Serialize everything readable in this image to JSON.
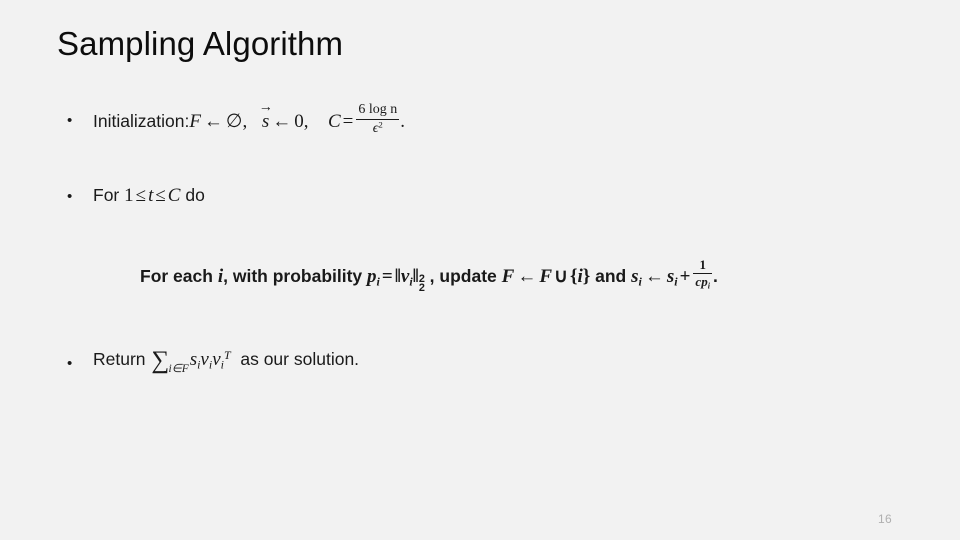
{
  "slide": {
    "title": "Sampling Algorithm",
    "page_number": "16",
    "background_color": "#f2f2f2",
    "text_color": "#1a1a1a",
    "page_number_color": "#b0b0b0"
  },
  "bullets": [
    {
      "marker": "•",
      "kind": "bullet",
      "plain_text": "Initialization: F ← ∅,  s⃗ ← 0,  C = 6 log n / ε².",
      "parts": {
        "label": "Initialization:",
        "var_f": "F",
        "arrow": "←",
        "empty_set": "∅",
        "comma1": ",",
        "var_s": "s",
        "vec_arrow": "→",
        "arrow2": "←",
        "zero": "0",
        "comma2": ",",
        "var_c": "C",
        "equals": "=",
        "frac_num": "6 log n",
        "frac_den": "ϵ",
        "frac_den_exp": "2",
        "period": "."
      }
    },
    {
      "marker": "•",
      "kind": "bullet",
      "plain_text": "For 1 ≤ t ≤ C do",
      "parts": {
        "for": "For",
        "one": "1",
        "le1": "≤",
        "var_t": "t",
        "le2": "≤",
        "var_c": "C",
        "do": "do"
      }
    },
    {
      "marker": "",
      "kind": "sub",
      "plain_text": "For each i, with probability pᵢ = ‖vᵢ‖₂², update F ← F ∪ {i} and sᵢ ← sᵢ + 1/(cpᵢ).",
      "parts": {
        "for_each": "For each",
        "var_i": "i",
        "comma1": ",",
        "with_prob": "with probability",
        "var_p": "p",
        "sub_i": "i",
        "equals": "=",
        "norm_open": "‖",
        "var_v": "v",
        "norm_close": "‖",
        "norm_sup": "2",
        "norm_sub": "2",
        "comma2": ",",
        "update": "update",
        "var_f": "F",
        "arrow1": "←",
        "var_f2": "F",
        "union": "∪",
        "brace_open": "{",
        "set_i": "i",
        "brace_close": "}",
        "and": "and",
        "var_s": "s",
        "arrow2": "←",
        "var_s2": "s",
        "plus": "+",
        "frac_num": "1",
        "frac_den_c": "c",
        "frac_den_p": "p",
        "period": "."
      }
    },
    {
      "marker": "•",
      "kind": "bullet",
      "plain_text": "Return Σᵢ∈F sᵢ vᵢ vᵢᵀ as our solution.",
      "parts": {
        "return": "Return",
        "sigma": "∑",
        "sigma_sub": "i∈F",
        "var_s": "s",
        "var_v1": "v",
        "var_v2": "v",
        "transpose": "T",
        "sub_i": "i",
        "tail": "as our solution."
      }
    }
  ]
}
